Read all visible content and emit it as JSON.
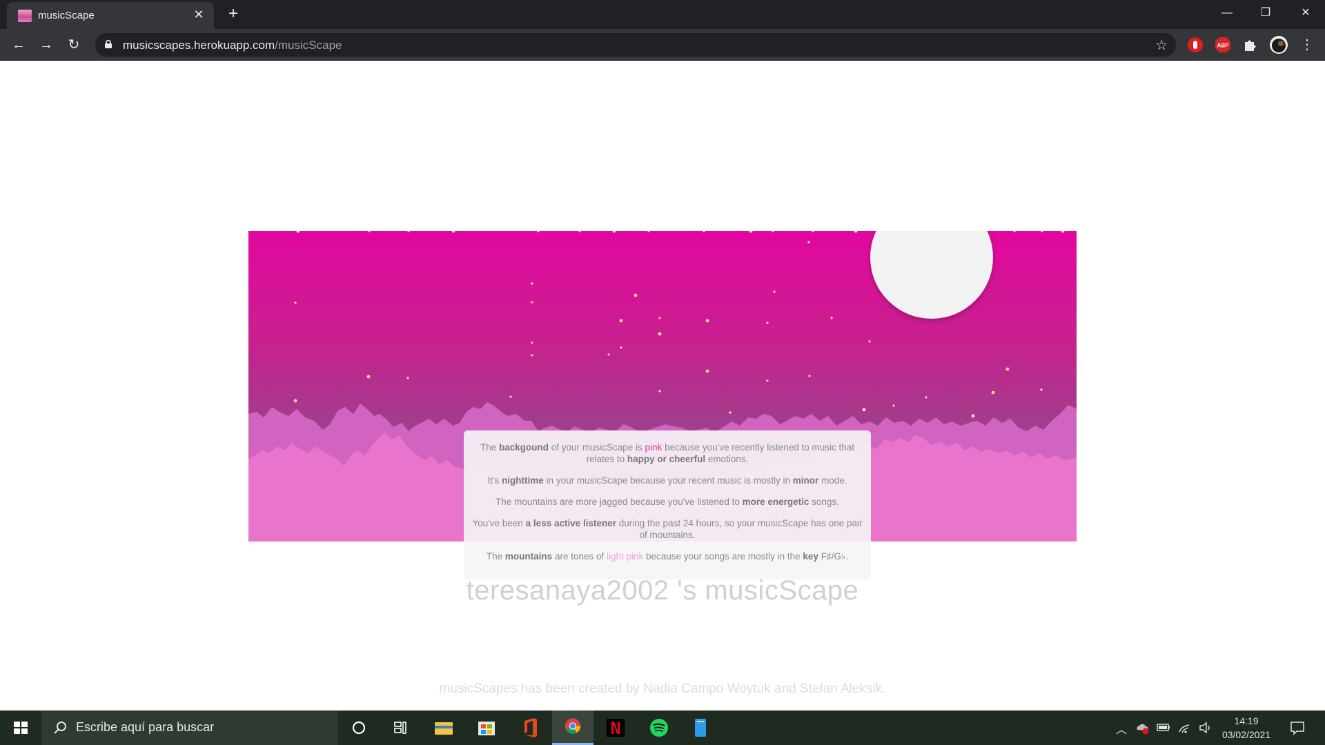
{
  "browser": {
    "tab_title": "musicScape",
    "new_tab_label": "+",
    "url_host": "musicscapes.herokuapp.com",
    "url_path": "/musicScape",
    "window_controls": [
      "minimize-icon",
      "restore-icon",
      "close-icon"
    ],
    "extensions": [
      "hand-stop-extension-icon",
      "adblock-plus-icon",
      "puzzle-extensions-icon",
      "profile-avatar"
    ],
    "extension_labels": {
      "adblock": "ABP"
    }
  },
  "scape": {
    "background_color": "#e2079e",
    "time_of_day": "nighttime",
    "mountain_color": "#e874cc"
  },
  "info": {
    "p1_a": "The ",
    "p1_b": "backgound",
    "p1_c": " of your musicScape is ",
    "p1_d": "pink",
    "p1_e": " because you've recently listened to music that relates to ",
    "p1_f": "happy or cheerful",
    "p1_g": " emotions.",
    "p2_a": "It's ",
    "p2_b": "nighttime",
    "p2_c": " in your musicScape because your recent music is mostly in ",
    "p2_d": "minor",
    "p2_e": " mode.",
    "p3_a": "The mountains are more jagged because you've listened to ",
    "p3_b": "more energetic",
    "p3_c": " songs.",
    "p4_a": "You've been ",
    "p4_b": "a less active listener",
    "p4_c": " during the past 24 hours, so your musicScape has one pair of mountains.",
    "p5_a": "The ",
    "p5_b": "mountains",
    "p5_c": " are tones of ",
    "p5_d": "light pink",
    "p5_e": " because your songs are mostly in the ",
    "p5_f": "key",
    "p5_g": " F♯/G♭."
  },
  "page": {
    "title": "teresanaya2002 's musicScape",
    "credits": "musicScapes has been created by Nadia Campo Woytuk and Stefan Aleksik."
  },
  "taskbar": {
    "search_placeholder": "Escribe aquí para buscar",
    "apps": [
      "cortana-icon",
      "task-view-icon",
      "file-explorer-icon",
      "store-icon",
      "office-icon",
      "chrome-icon",
      "netflix-icon",
      "spotify-icon",
      "notes-icon"
    ],
    "time": "14:19",
    "date": "03/02/2021"
  }
}
